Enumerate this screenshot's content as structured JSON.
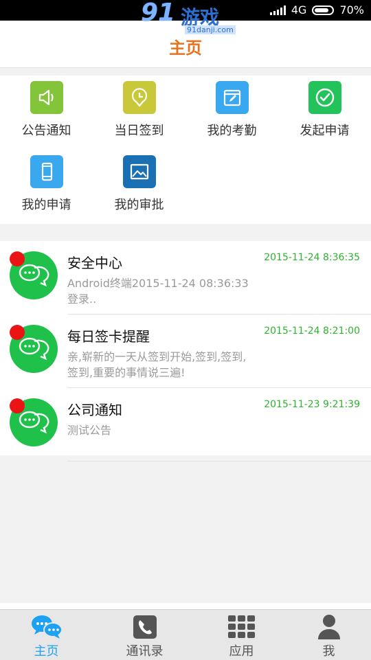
{
  "status_bar": {
    "network": "4G",
    "battery": "70%"
  },
  "watermark": {
    "text": "91游戏",
    "site": "91danji.com"
  },
  "header": {
    "title": "主页"
  },
  "grid": [
    {
      "label": "公告通知",
      "icon": "speaker-icon",
      "color": "#84c43a"
    },
    {
      "label": "当日签到",
      "icon": "clock-pin-icon",
      "color": "#c9c83a"
    },
    {
      "label": "我的考勤",
      "icon": "calendar-edit-icon",
      "color": "#3aa8ee"
    },
    {
      "label": "发起申请",
      "icon": "check-circle-icon",
      "color": "#23c25a"
    },
    {
      "label": "我的申请",
      "icon": "phone-icon",
      "color": "#3aa8ee"
    },
    {
      "label": "我的审批",
      "icon": "picture-icon",
      "color": "#1b6fb3"
    }
  ],
  "messages": [
    {
      "title": "安全中心",
      "time": "2015-11-24 8:36:35",
      "subtitle": "Android终端2015-11-24 08:36:33登录.."
    },
    {
      "title": "每日签卡提醒",
      "time": "2015-11-24 8:21:00",
      "subtitle": "亲,崭新的一天从签到开始,签到,签到,签到,重要的事情说三遍!"
    },
    {
      "title": "公司通知",
      "time": "2015-11-23 9:21:39",
      "subtitle": "测试公告"
    }
  ],
  "nav": [
    {
      "label": "主页",
      "icon": "chat-bubbles-icon",
      "active": true
    },
    {
      "label": "通讯录",
      "icon": "phone-handset-icon",
      "active": false
    },
    {
      "label": "应用",
      "icon": "apps-grid-icon",
      "active": false
    },
    {
      "label": "我",
      "icon": "person-icon",
      "active": false
    }
  ]
}
